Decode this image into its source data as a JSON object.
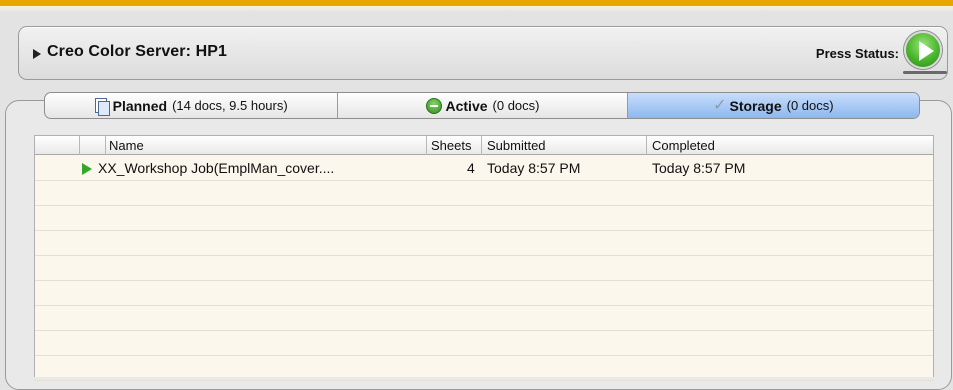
{
  "server": {
    "title": "Creo Color Server: HP1",
    "press_status_label": "Press Status:"
  },
  "tabs": [
    {
      "name": "Planned",
      "count": "(14 docs, 9.5 hours)",
      "icon": "planned-docs-icon"
    },
    {
      "name": "Active",
      "count": "(0 docs)",
      "icon": "active-minus-icon"
    },
    {
      "name": "Storage",
      "count": "(0 docs)",
      "icon": "storage-check-icon",
      "selected": true
    }
  ],
  "table": {
    "columns": [
      "Name",
      "Sheets",
      "Submitted",
      "Completed"
    ],
    "rows": [
      {
        "name": "XX_Workshop Job(EmplMan_cover....",
        "sheets": "4",
        "submitted": "Today 8:57 PM",
        "completed": "Today 8:57 PM",
        "status_icon": "play-icon"
      }
    ]
  },
  "colors": {
    "accent_bar": "#e8a700",
    "selected_tab": "#8db8ef",
    "status_green": "#30a82a",
    "table_bg": "#fbf7ec"
  }
}
